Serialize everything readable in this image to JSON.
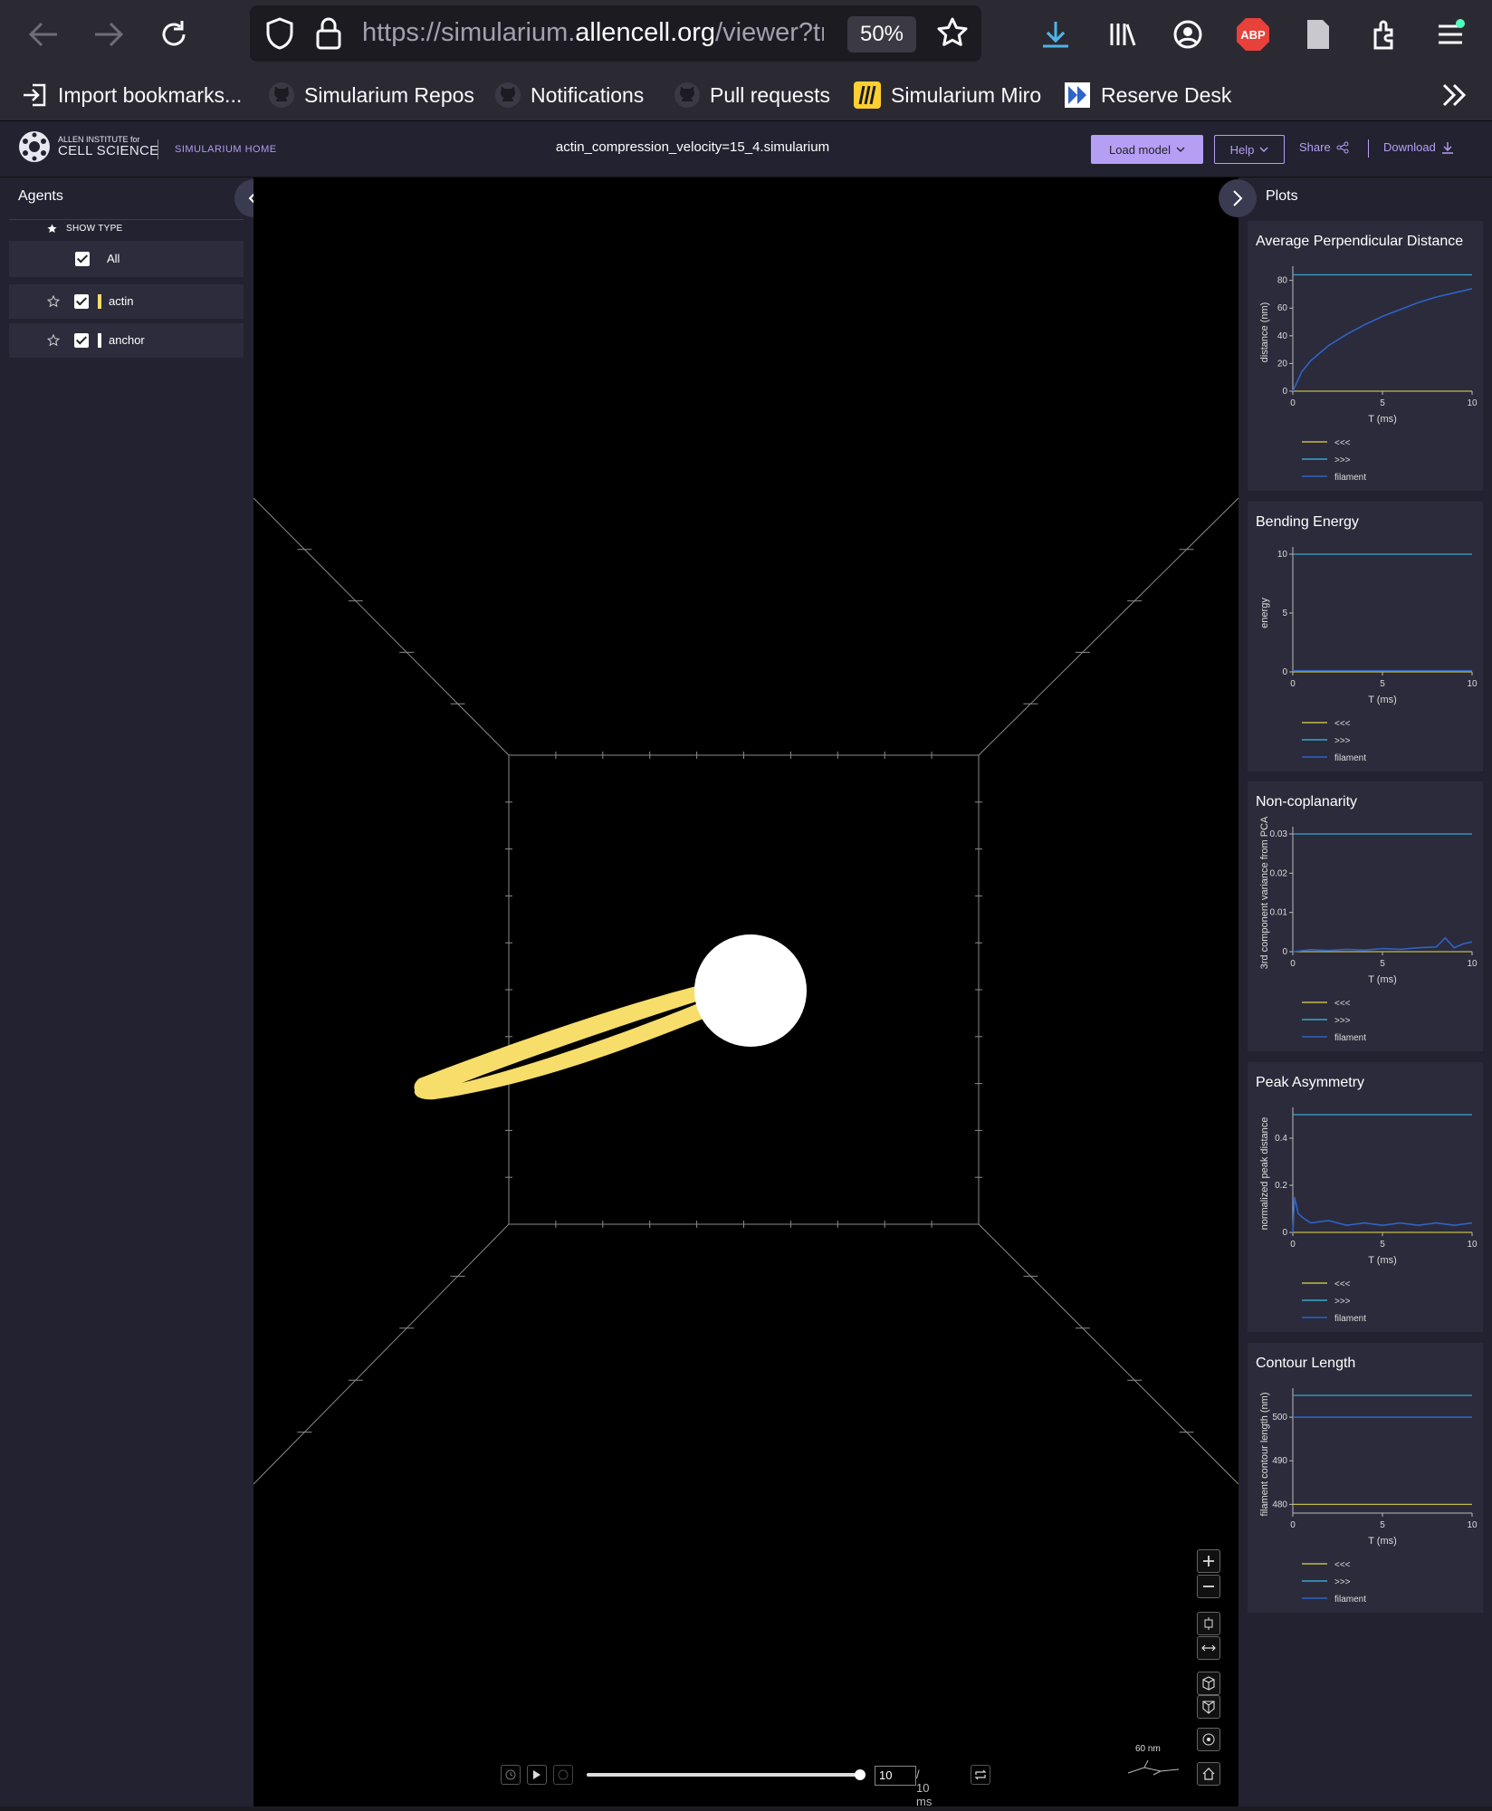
{
  "browser": {
    "url_domain": "https://simularium.",
    "url_host": "allencell.org",
    "url_path": "/viewer?tra",
    "zoom": "50%",
    "abp": "ABP"
  },
  "bookmarks": [
    {
      "label": "Import bookmarks...",
      "icon": "import-icon"
    },
    {
      "label": "Simularium Repos",
      "icon": "github-icon"
    },
    {
      "label": "Notifications",
      "icon": "github-icon"
    },
    {
      "label": "Pull requests",
      "icon": "github-icon"
    },
    {
      "label": "Simularium Miro",
      "icon": "miro-icon"
    },
    {
      "label": "Reserve Desk",
      "icon": "desk-icon"
    }
  ],
  "header": {
    "logo_small": "ALLEN INSTITUTE for",
    "logo_large": "CELL SCIENCE",
    "home": "SIMULARIUM HOME",
    "file_name": "actin_compression_velocity=15_4.simularium",
    "load_model": "Load model",
    "help": "Help",
    "share": "Share",
    "download": "Download"
  },
  "agents_panel": {
    "title": "Agents",
    "show_type": "SHOW TYPE",
    "rows": [
      {
        "label": "All",
        "checked": true,
        "color": ""
      },
      {
        "label": "actin",
        "checked": true,
        "color": "#f7dd6a"
      },
      {
        "label": "anchor",
        "checked": true,
        "color": "#ffffff"
      }
    ]
  },
  "plots_panel": {
    "title": "Plots",
    "plots": [
      {
        "title": "Average Perpendicular Distance",
        "ylabel": "distance (nm)",
        "xlabel": "T (ms)",
        "yticks": [
          "0",
          "20",
          "40",
          "60",
          "80"
        ],
        "xticks": [
          "0",
          "5",
          "10"
        ],
        "legend": [
          "<<<",
          ">>>",
          "filament"
        ]
      },
      {
        "title": "Bending Energy",
        "ylabel": "energy",
        "xlabel": "T (ms)",
        "yticks": [
          "0",
          "5",
          "10"
        ],
        "xticks": [
          "0",
          "5",
          "10"
        ],
        "legend": [
          "<<<",
          ">>>",
          "filament"
        ]
      },
      {
        "title": "Non-coplanarity",
        "ylabel": "3rd component variance from PCA",
        "xlabel": "T (ms)",
        "yticks": [
          "0",
          "0.01",
          "0.02",
          "0.03"
        ],
        "xticks": [
          "0",
          "5",
          "10"
        ],
        "legend": [
          "<<<",
          ">>>",
          "filament"
        ]
      },
      {
        "title": "Peak Asymmetry",
        "ylabel": "normalized peak distance",
        "xlabel": "T (ms)",
        "yticks": [
          "0",
          "0.2",
          "0.4"
        ],
        "xticks": [
          "0",
          "5",
          "10"
        ],
        "legend": [
          "<<<",
          ">>>",
          "filament"
        ]
      },
      {
        "title": "Contour Length",
        "ylabel": "filament contour length (nm)",
        "xlabel": "T (ms)",
        "yticks": [
          "480",
          "490",
          "500"
        ],
        "xticks": [
          "0",
          "5",
          "10"
        ],
        "legend": [
          "<<<",
          ">>>",
          "filament"
        ]
      }
    ]
  },
  "chart_data": [
    {
      "type": "line",
      "title": "Average Perpendicular Distance",
      "xlabel": "T (ms)",
      "ylabel": "distance (nm)",
      "xlim": [
        0,
        10
      ],
      "ylim": [
        0,
        85
      ],
      "series": [
        {
          "name": "<<<",
          "color": "#c4b94a",
          "x": [
            0,
            10
          ],
          "y": [
            0,
            0
          ]
        },
        {
          "name": ">>>",
          "color": "#3aa6c9",
          "x": [
            0,
            10
          ],
          "y": [
            84,
            84
          ]
        },
        {
          "name": "filament",
          "color": "#2e63c7",
          "x": [
            0,
            0.5,
            1,
            2,
            3,
            4,
            5,
            6,
            7,
            8,
            9,
            10
          ],
          "y": [
            0,
            14,
            22,
            33,
            41,
            48,
            54,
            59,
            64,
            68,
            71,
            74
          ]
        }
      ]
    },
    {
      "type": "line",
      "title": "Bending Energy",
      "xlabel": "T (ms)",
      "ylabel": "energy",
      "xlim": [
        0,
        10
      ],
      "ylim": [
        0,
        10
      ],
      "series": [
        {
          "name": "<<<",
          "color": "#c4b94a",
          "x": [
            0,
            10
          ],
          "y": [
            0,
            0
          ]
        },
        {
          "name": ">>>",
          "color": "#3aa6c9",
          "x": [
            0,
            10
          ],
          "y": [
            10,
            10
          ]
        },
        {
          "name": "filament",
          "color": "#2e63c7",
          "x": [
            0,
            2,
            4,
            6,
            8,
            10
          ],
          "y": [
            0.1,
            0.1,
            0.1,
            0.1,
            0.1,
            0.1
          ]
        }
      ]
    },
    {
      "type": "line",
      "title": "Non-coplanarity",
      "xlabel": "T (ms)",
      "ylabel": "3rd component variance from PCA",
      "xlim": [
        0,
        10
      ],
      "ylim": [
        0,
        0.03
      ],
      "series": [
        {
          "name": "<<<",
          "color": "#c4b94a",
          "x": [
            0,
            10
          ],
          "y": [
            0,
            0
          ]
        },
        {
          "name": ">>>",
          "color": "#3aa6c9",
          "x": [
            0,
            10
          ],
          "y": [
            0.03,
            0.03
          ]
        },
        {
          "name": "filament",
          "color": "#2e63c7",
          "x": [
            0,
            1,
            2,
            3,
            4,
            5,
            6,
            7,
            8,
            8.5,
            9,
            9.5,
            10
          ],
          "y": [
            0,
            0.0005,
            0.0003,
            0.0006,
            0.0004,
            0.0008,
            0.0006,
            0.001,
            0.0012,
            0.0035,
            0.001,
            0.002,
            0.0025
          ]
        }
      ]
    },
    {
      "type": "line",
      "title": "Peak Asymmetry",
      "xlabel": "T (ms)",
      "ylabel": "normalized peak distance",
      "xlim": [
        0,
        10
      ],
      "ylim": [
        0,
        0.5
      ],
      "series": [
        {
          "name": "<<<",
          "color": "#c4b94a",
          "x": [
            0,
            10
          ],
          "y": [
            0,
            0
          ]
        },
        {
          "name": ">>>",
          "color": "#3aa6c9",
          "x": [
            0,
            10
          ],
          "y": [
            0.5,
            0.5
          ]
        },
        {
          "name": "filament",
          "color": "#2e63c7",
          "x": [
            0,
            0.1,
            0.3,
            0.6,
            1,
            2,
            3,
            4,
            5,
            6,
            7,
            8,
            9,
            10
          ],
          "y": [
            0,
            0.15,
            0.08,
            0.06,
            0.04,
            0.05,
            0.03,
            0.04,
            0.03,
            0.04,
            0.03,
            0.04,
            0.03,
            0.04
          ]
        }
      ]
    },
    {
      "type": "line",
      "title": "Contour Length",
      "xlabel": "T (ms)",
      "ylabel": "filament contour length (nm)",
      "xlim": [
        0,
        10
      ],
      "ylim": [
        478,
        505
      ],
      "series": [
        {
          "name": "<<<",
          "color": "#c4b94a",
          "x": [
            0,
            10
          ],
          "y": [
            480,
            480
          ]
        },
        {
          "name": ">>>",
          "color": "#3aa6c9",
          "x": [
            0,
            10
          ],
          "y": [
            505,
            505
          ]
        },
        {
          "name": "filament",
          "color": "#2e63c7",
          "x": [
            0,
            10
          ],
          "y": [
            500,
            500
          ]
        }
      ]
    }
  ],
  "playback": {
    "current_time": "10",
    "total_time": "/ 10 ms",
    "progress": 1.0,
    "scale_label": "60 nm"
  },
  "colors": {
    "accent": "#b59ff5",
    "actin": "#f7dd6a",
    "anchor": "#ffffff"
  }
}
